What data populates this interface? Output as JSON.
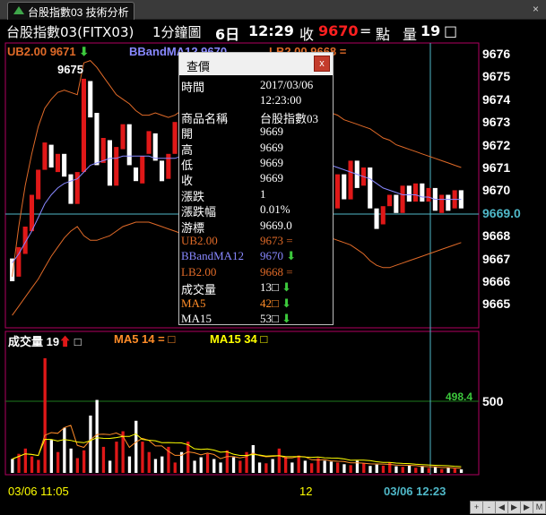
{
  "window": {
    "tab_label": "台股指數03 技術分析",
    "close": "×"
  },
  "header": {
    "name": "台股指數03(FITX03)",
    "period": "1分鐘圖",
    "day": "6日",
    "time": "12:29",
    "close_label": "收",
    "close_value": "9670",
    "change_sym": "=",
    "unit": "點",
    "volume_label": "量",
    "volume_value": "19",
    "box": "□"
  },
  "legend": {
    "ub": "UB2.00 9671",
    "bband": "BBandMA12 9670",
    "lb": "LB2.00 9668 ="
  },
  "price_axis": {
    "ticks": [
      "9676",
      "9675",
      "9674",
      "9673",
      "9672",
      "9671",
      "9670",
      "9669.0",
      "9668",
      "9667",
      "9666",
      "9665"
    ],
    "high_label": "9675"
  },
  "volume_axis": {
    "tick": "500",
    "line_value": "498.4"
  },
  "volume_legend": {
    "vol": "成交量 19",
    "ma5": "MA5 14 = □",
    "ma15": "MA15 34 □"
  },
  "x_axis": {
    "start": "03/06 11:05",
    "mid": "12",
    "cursor": "03/06 12:23"
  },
  "popup": {
    "title": "查價",
    "close": "x",
    "rows": [
      {
        "k": "時間",
        "v": "2017/03/06"
      },
      {
        "k": "",
        "v": "12:23:00"
      },
      {
        "k": "商品名稱",
        "v": "台股指數03"
      },
      {
        "k": "開",
        "v": "9669"
      },
      {
        "k": "高",
        "v": "9669"
      },
      {
        "k": "低",
        "v": "9669"
      },
      {
        "k": "收",
        "v": "9669"
      },
      {
        "k": "漲跌",
        "v": "1"
      },
      {
        "k": "漲跌幅",
        "v": "0.01%"
      },
      {
        "k": "游標",
        "v": "9669.0"
      },
      {
        "k": "UB2.00",
        "v": "9673 ="
      },
      {
        "k": "BBandMA12",
        "v": "9670"
      },
      {
        "k": "LB2.00",
        "v": "9668 ="
      },
      {
        "k": "成交量",
        "v": "13□"
      },
      {
        "k": "MA5",
        "v": "42□"
      },
      {
        "k": "MA15",
        "v": "53□"
      }
    ]
  },
  "colors": {
    "up": "#e01818",
    "down": "#ffffff",
    "ub": "#e06a28",
    "bband": "#8888ff",
    "lb": "#e06a28",
    "ma5": "#ff8c28",
    "ma15": "#ffff00",
    "frame": "#b00060",
    "grid": "#1e7a1e",
    "cursor": "#4fb8c8"
  },
  "chart_data": {
    "type": "candlestick",
    "title": "台股指數03(FITX03) 1分鐘圖",
    "ylim": [
      9664.5,
      9676.5
    ],
    "candles": [
      {
        "o": 9667.0,
        "c": 9666.0
      },
      {
        "o": 9666.2,
        "c": 9667.5
      },
      {
        "o": 9667.2,
        "c": 9668.4
      },
      {
        "o": 9668.2,
        "c": 9669.8
      },
      {
        "o": 9669.6,
        "c": 9670.9
      },
      {
        "o": 9670.9,
        "c": 9672.1
      },
      {
        "o": 9672.0,
        "c": 9671.0
      },
      {
        "o": 9670.8,
        "c": 9671.6
      },
      {
        "o": 9671.6,
        "c": 9670.6
      },
      {
        "o": 9670.7,
        "c": 9669.4
      },
      {
        "o": 9669.4,
        "c": 9670.8
      },
      {
        "o": 9670.8,
        "c": 9674.9
      },
      {
        "o": 9674.8,
        "c": 9673.2
      },
      {
        "o": 9673.4,
        "c": 9671.1
      },
      {
        "o": 9671.2,
        "c": 9672.3
      },
      {
        "o": 9672.2,
        "c": 9670.2
      },
      {
        "o": 9670.2,
        "c": 9671.9
      },
      {
        "o": 9671.8,
        "c": 9672.9
      },
      {
        "o": 9672.9,
        "c": 9671.1
      },
      {
        "o": 9671.0,
        "c": 9670.4
      },
      {
        "o": 9670.3,
        "c": 9671.5
      },
      {
        "o": 9671.6,
        "c": 9672.6
      },
      {
        "o": 9672.5,
        "c": 9671.3
      },
      {
        "o": 9671.3,
        "c": 9670.4
      },
      {
        "o": 9670.5,
        "c": 9671.6
      },
      {
        "o": 9671.6,
        "c": 9673.0
      },
      {
        "o": 9673.0,
        "c": 9672.1
      },
      {
        "o": 9672.0,
        "c": 9673.1
      },
      {
        "o": 9673.1,
        "c": 9671.9
      },
      {
        "o": 9671.9,
        "c": 9670.8
      },
      {
        "o": 9670.8,
        "c": 9672.2
      },
      {
        "o": 9672.1,
        "c": 9671.0
      },
      {
        "o": 9671.1,
        "c": 9670.0
      },
      {
        "o": 9670.0,
        "c": 9670.9
      },
      {
        "o": 9670.8,
        "c": 9669.4
      },
      {
        "o": 9669.4,
        "c": 9670.5
      },
      {
        "o": 9670.6,
        "c": 9671.4
      },
      {
        "o": 9671.3,
        "c": 9670.0
      },
      {
        "o": 9670.0,
        "c": 9669.0
      },
      {
        "o": 9669.1,
        "c": 9670.3
      },
      {
        "o": 9670.4,
        "c": 9669.1
      },
      {
        "o": 9669.1,
        "c": 9670.4
      },
      {
        "o": 9670.4,
        "c": 9671.7
      },
      {
        "o": 9671.7,
        "c": 9670.6
      },
      {
        "o": 9670.5,
        "c": 9672.2
      },
      {
        "o": 9672.2,
        "c": 9670.9
      },
      {
        "o": 9670.9,
        "c": 9671.8
      },
      {
        "o": 9671.7,
        "c": 9673.2
      },
      {
        "o": 9673.2,
        "c": 9671.2
      },
      {
        "o": 9671.1,
        "c": 9669.2
      },
      {
        "o": 9669.2,
        "c": 9670.7
      },
      {
        "o": 9670.7,
        "c": 9669.6
      },
      {
        "o": 9669.6,
        "c": 9671.3
      },
      {
        "o": 9671.3,
        "c": 9670.1
      },
      {
        "o": 9670.2,
        "c": 9671.0
      },
      {
        "o": 9671.0,
        "c": 9669.2
      },
      {
        "o": 9669.2,
        "c": 9668.3
      },
      {
        "o": 9668.5,
        "c": 9669.3
      },
      {
        "o": 9669.3,
        "c": 9669.8
      },
      {
        "o": 9669.8,
        "c": 9669.0
      },
      {
        "o": 9669.0,
        "c": 9670.2
      },
      {
        "o": 9670.2,
        "c": 9669.5
      },
      {
        "o": 9669.5,
        "c": 9670.3
      },
      {
        "o": 9670.3,
        "c": 9669.5
      },
      {
        "o": 9669.5,
        "c": 9670.1
      },
      {
        "o": 9670.1,
        "c": 9669.1
      },
      {
        "o": 9669.0,
        "c": 9669.8
      },
      {
        "o": 9669.8,
        "c": 9669.1
      },
      {
        "o": 9669.2,
        "c": 9670.0
      },
      {
        "o": 9670.0,
        "c": 9669.2
      }
    ],
    "ub_line": [
      9666.2,
      9668.4,
      9670.2,
      9671.6,
      9672.8,
      9673.6,
      9674.0,
      9674.3,
      9674.4,
      9674.3,
      9674.2,
      9675.6,
      9675.7,
      9675.4,
      9675.0,
      9674.6,
      9674.2,
      9674.0,
      9673.8,
      9673.5,
      9673.3,
      9673.3,
      9673.4,
      9673.3,
      9673.2,
      9673.3,
      9673.5,
      9673.7,
      9673.8,
      9673.8,
      9673.7,
      9673.6,
      9673.3,
      9673.0,
      9672.8,
      9672.6,
      9672.7,
      9672.8,
      9672.8,
      9672.6,
      9672.4,
      9672.3,
      9672.4,
      9672.5,
      9672.7,
      9672.9,
      9673.0,
      9673.2,
      9673.4,
      9673.4,
      9673.3,
      9673.1,
      9673.0,
      9672.9,
      9672.8,
      9672.7,
      9672.5,
      9672.3,
      9672.2,
      9672.0,
      9671.9,
      9671.8,
      9671.7,
      9671.6,
      9671.5,
      9671.4,
      9671.3,
      9671.2,
      9671.1,
      9671.0
    ],
    "bband_line": [
      9666.8,
      9667.2,
      9667.7,
      9668.2,
      9668.8,
      9669.4,
      9669.8,
      9670.1,
      9670.3,
      9670.4,
      9670.5,
      9670.8,
      9671.1,
      9671.2,
      9671.3,
      9671.4,
      9671.4,
      9671.5,
      9671.5,
      9671.5,
      9671.5,
      9671.5,
      9671.4,
      9671.4,
      9671.4,
      9671.4,
      9671.5,
      9671.6,
      9671.7,
      9671.7,
      9671.6,
      9671.5,
      9671.4,
      9671.3,
      9671.2,
      9671.1,
      9671.0,
      9670.9,
      9670.8,
      9670.7,
      9670.6,
      9670.5,
      9670.6,
      9670.6,
      9670.7,
      9670.8,
      9670.9,
      9671.0,
      9671.1,
      9671.1,
      9671.0,
      9670.9,
      9670.8,
      9670.7,
      9670.6,
      9670.5,
      9670.3,
      9670.1,
      9670.0,
      9669.9,
      9669.8,
      9669.8,
      9669.8,
      9669.7,
      9669.7,
      9669.6,
      9669.6,
      9669.6,
      9669.6,
      9669.6
    ],
    "lb_line": [
      9664.5,
      9664.9,
      9665.3,
      9665.7,
      9666.1,
      9666.6,
      9667.1,
      9667.5,
      9667.9,
      9668.2,
      9668.4,
      9668.0,
      9667.8,
      9667.8,
      9667.9,
      9668.0,
      9668.2,
      9668.4,
      9668.5,
      9668.6,
      9668.6,
      9668.6,
      9668.5,
      9668.4,
      9668.3,
      9668.2,
      9668.1,
      9668.1,
      9668.1,
      9668.2,
      9668.3,
      9668.4,
      9668.4,
      9668.5,
      9668.4,
      9668.3,
      9668.2,
      9668.1,
      9667.9,
      9667.8,
      9667.7,
      9667.7,
      9667.8,
      9667.9,
      9668.0,
      9668.0,
      9668.0,
      9668.0,
      9668.0,
      9667.9,
      9667.8,
      9667.7,
      9667.6,
      9667.4,
      9667.2,
      9666.9,
      9666.7,
      9666.6,
      9666.6,
      9666.7,
      9666.8,
      9666.9,
      9667.0,
      9667.1,
      9667.2,
      9667.3,
      9667.4,
      9667.5,
      9667.6,
      9667.7
    ],
    "volume": [
      80,
      110,
      140,
      95,
      75,
      660,
      190,
      120,
      260,
      140,
      85,
      130,
      330,
      420,
      150,
      70,
      180,
      240,
      95,
      300,
      180,
      120,
      80,
      95,
      150,
      60,
      120,
      180,
      70,
      90,
      110,
      80,
      60,
      130,
      90,
      70,
      120,
      160,
      60,
      55,
      80,
      140,
      95,
      60,
      100,
      70,
      55,
      85,
      70,
      65,
      60,
      50,
      45,
      70,
      55,
      40,
      48,
      42,
      60,
      38,
      35,
      45,
      30,
      40,
      28,
      35,
      22,
      30,
      25,
      20
    ],
    "volume_ylim": [
      0,
      780
    ],
    "volume_line": 498.4
  }
}
